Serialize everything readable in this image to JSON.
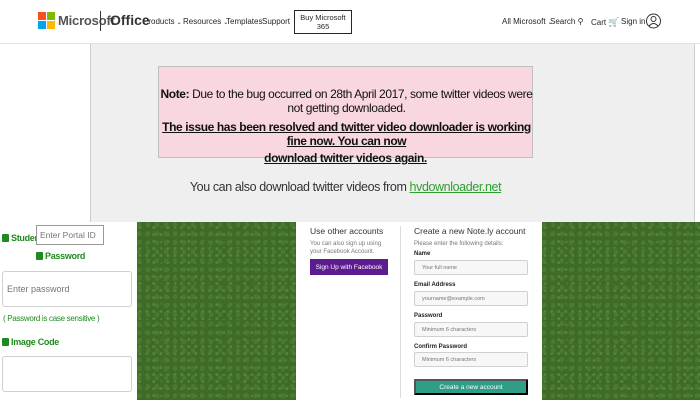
{
  "header": {
    "brand": "Microsoft",
    "product": "Office",
    "nav": [
      {
        "label": "Products",
        "has_chevron": true
      },
      {
        "label": "Resources",
        "has_chevron": true
      },
      {
        "label": "Templates",
        "has_chevron": false
      },
      {
        "label": "Support",
        "has_chevron": false
      }
    ],
    "buy_button": "Buy Microsoft 365",
    "all_microsoft": "All Microsoft",
    "search": "Search",
    "cart": "Cart",
    "sign_in": "Sign in"
  },
  "notice": {
    "note_label": "Note:",
    "note_text": " Due to the bug occurred on 28th April 2017, some twitter videos were not getting downloaded.",
    "resolved_line1": "The issue has been resolved and twitter video downloader is working fine now. You can now",
    "resolved_line2": "download twitter videos again.",
    "also_text": "You can also download twitter videos from ",
    "also_link": "hvdownloader.net"
  },
  "login": {
    "student_id_label": "Student ID",
    "portal_id_placeholder": "Enter Portal ID",
    "password_label": "Password",
    "password_placeholder": "Enter password",
    "case_sensitive_note": "( Password is case sensitive )",
    "image_code_label": "Image Code"
  },
  "signup": {
    "other_heading": "Use other accounts",
    "other_desc": "You can also sign up using your Facebook Account.",
    "facebook_button": "Sign Up with Facebook",
    "create_heading": "Create a new Note.ly account",
    "create_desc": "Please enter the following details:",
    "name_label": "Name",
    "name_placeholder": "Your full name",
    "email_label": "Email Address",
    "email_placeholder": "yourname@example.com",
    "password_label": "Password",
    "password_placeholder": "Minimum 6 characters",
    "confirm_label": "Confirm Password",
    "confirm_placeholder": "Minimum 6 characters",
    "create_button": "Create a new account"
  },
  "colors": {
    "note_bg": "#f8d7de",
    "link_green": "#2e9e2e",
    "facebook_purple": "#5c1b8f",
    "create_teal": "#2e9e87",
    "grass": "#3f6b28"
  }
}
